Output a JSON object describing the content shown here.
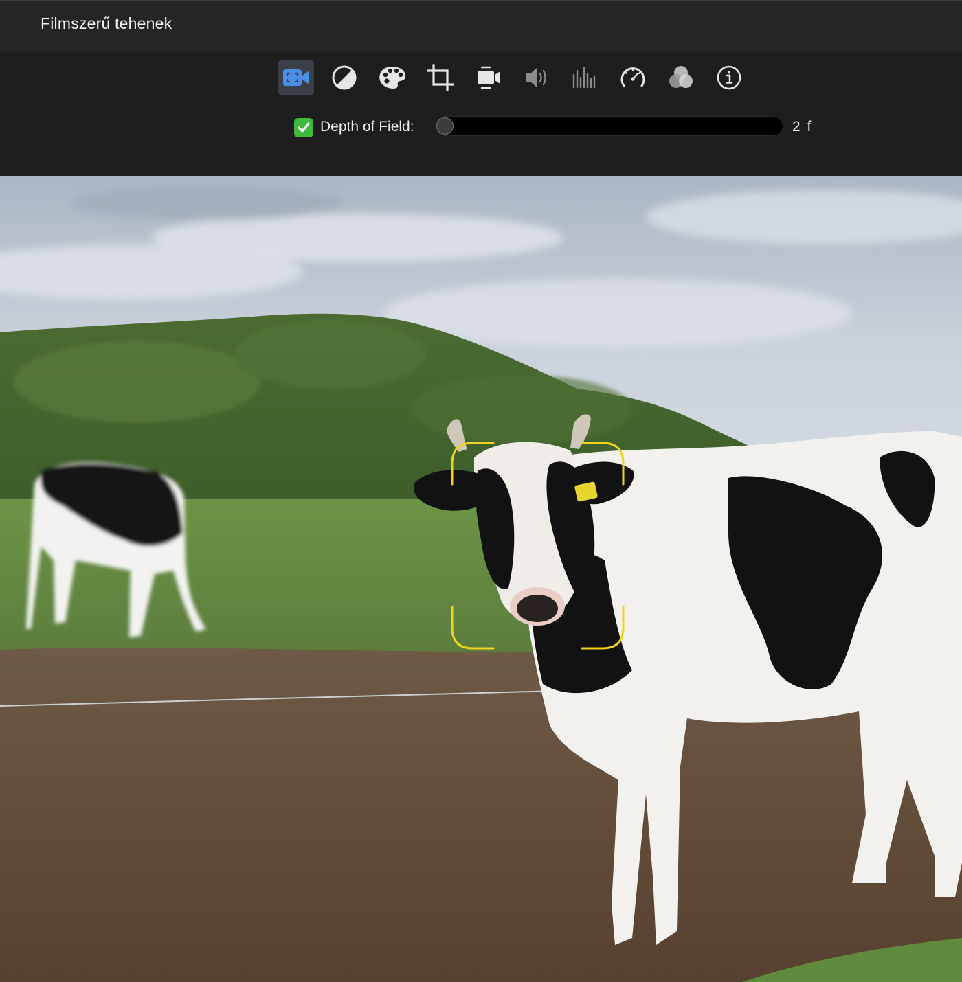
{
  "window": {
    "title": "Filmszerű tehenek"
  },
  "toolbar": {
    "tools": [
      {
        "name": "cinematic-camera",
        "active": true
      },
      {
        "name": "color-balance",
        "active": false
      },
      {
        "name": "color-correction",
        "active": false
      },
      {
        "name": "crop",
        "active": false
      },
      {
        "name": "stabilization",
        "active": false
      },
      {
        "name": "volume",
        "active": false
      },
      {
        "name": "noise-reduction",
        "active": false
      },
      {
        "name": "speed",
        "active": false
      },
      {
        "name": "clip-filter",
        "active": false
      },
      {
        "name": "clip-info",
        "active": false
      }
    ],
    "accent_color": "#4b8fe6"
  },
  "depth_of_field": {
    "enabled": true,
    "label": "Depth of Field:",
    "value_text": "2 f",
    "slider_fraction": 0.0
  },
  "viewer": {
    "focus_indicator_color": "#f0d21f"
  }
}
